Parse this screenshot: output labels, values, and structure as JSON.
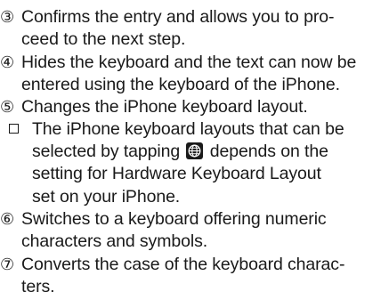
{
  "items": [
    {
      "marker": "③",
      "lines": [
        "Confirms the entry and allows you to pro-",
        "ceed to the next step."
      ]
    },
    {
      "marker": "④",
      "lines": [
        "Hides the keyboard and the text can now be",
        "entered using the keyboard of the iPhone."
      ]
    },
    {
      "marker": "⑤",
      "lines": [
        "Changes the iPhone keyboard layout."
      ]
    },
    {
      "marker": "⑥",
      "lines": [
        "Switches to a keyboard offering numeric",
        "characters and symbols."
      ]
    },
    {
      "marker": "⑦",
      "lines": [
        "Converts the case of the keyboard charac-",
        "ters."
      ]
    }
  ],
  "note": {
    "line1": "The iPhone keyboard layouts that can be",
    "line2_before": "selected by tapping",
    "line2_after": "depends on the",
    "line3": "setting for Hardware Keyboard Layout",
    "line4": "set on your iPhone."
  },
  "icons": {
    "note_marker": "checkbox-square-icon",
    "globe": "globe-icon"
  },
  "colors": {
    "text": "#1a1a1a",
    "globe_badge": "#1a1a1a"
  }
}
